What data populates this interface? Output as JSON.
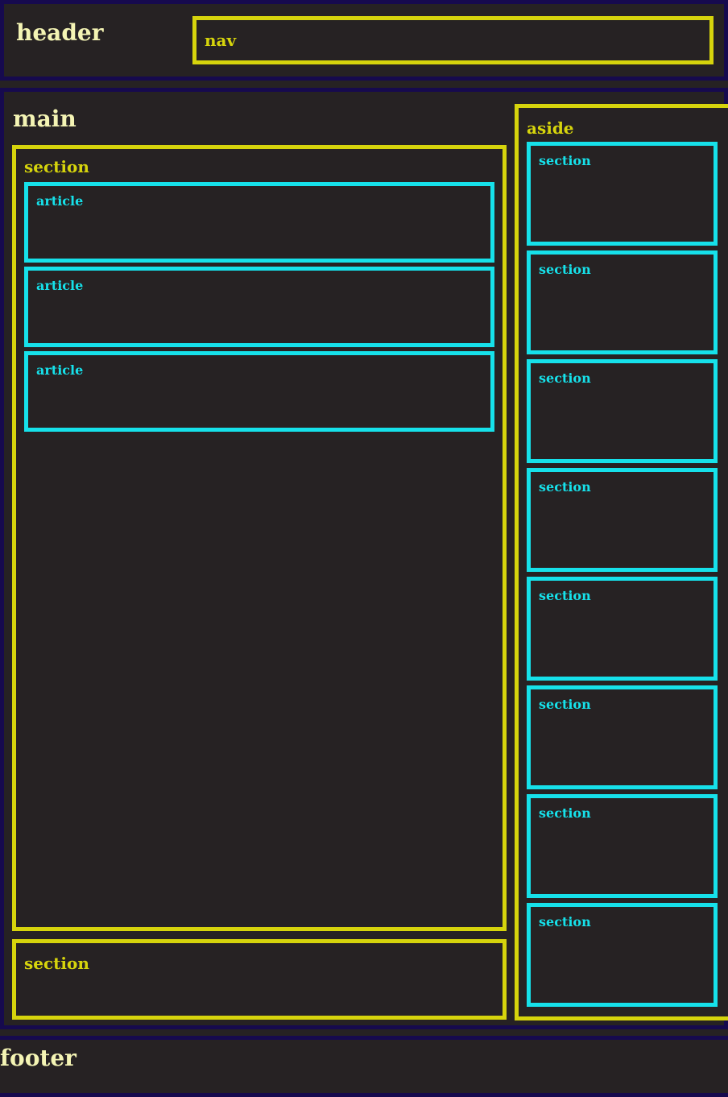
{
  "header": {
    "label": "header"
  },
  "nav": {
    "label": "nav"
  },
  "main": {
    "label": "main",
    "section_top": {
      "label": "section",
      "articles": [
        {
          "label": "article"
        },
        {
          "label": "article"
        },
        {
          "label": "article"
        }
      ]
    },
    "section_bottom": {
      "label": "section"
    }
  },
  "aside": {
    "label": "aside",
    "sections": [
      {
        "label": "section"
      },
      {
        "label": "section"
      },
      {
        "label": "section"
      },
      {
        "label": "section"
      },
      {
        "label": "section"
      },
      {
        "label": "section"
      },
      {
        "label": "section"
      },
      {
        "label": "section"
      }
    ]
  },
  "footer": {
    "label": "footer"
  },
  "colors": {
    "background": "#262223",
    "outer_border": "#160a4e",
    "container_border": "#d6d40c",
    "leaf_border": "#16e1ea",
    "title_text": "#f4f4b4"
  }
}
